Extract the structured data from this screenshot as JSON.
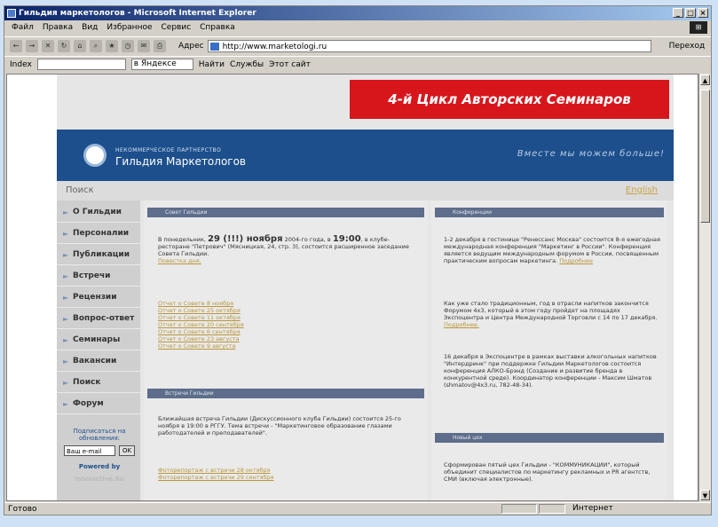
{
  "window": {
    "title": "Гильдия маркетологов - Microsoft Internet Explorer"
  },
  "menu": [
    "Файл",
    "Правка",
    "Вид",
    "Избранное",
    "Сервис",
    "Справка"
  ],
  "address": {
    "label": "Адрес",
    "url": "http://www.marketologi.ru",
    "go": "Переход"
  },
  "linksbar": {
    "left_label": "Index",
    "search_select": "в Яндексе",
    "find": "Найти",
    "services": "Службы",
    "this_site": "Этот сайт"
  },
  "status": {
    "left": "Готово",
    "zone": "Интернет"
  },
  "site": {
    "banner": "4-й Цикл Авторских Семинаров",
    "org_small": "НЕКОММЕРЧЕСКОЕ ПАРТНЕРСТВО",
    "org_big": "Гильдия Маркетологов",
    "slogan": "Вместе мы можем больше!",
    "search": "Поиск",
    "english": "English",
    "nav": [
      "О Гильдии",
      "Персоналии",
      "Публикации",
      "Встречи",
      "Рецензии",
      "Вопрос-ответ",
      "Семинары",
      "Вакансии",
      "Поиск",
      "Форум"
    ],
    "subscribe": "Подписаться на обновления:",
    "email_placeholder": "Ваш e-mail",
    "ok": "OK",
    "powered": "Powered by",
    "powered_name": "Interactive.Ru"
  },
  "council": {
    "head": "Совет Гильдии",
    "text_prefix": "В понедельник,",
    "date_big": "29 (!!!) ноября",
    "text_mid": "2004-го года, в",
    "time_big": "19:00",
    "text_rest": ", в клубе-ресторане \"Петрович\" (Мясницкая, 24, стр. 3), состоится расширенное заседание Совета Гильдии.",
    "agenda": "Повестка дня.",
    "reports": [
      "Отчет о Совете 8 ноября",
      "Отчет о Совете 25 октября",
      "Отчет о Совете 11 октября",
      "Отчет о Совете 20 сентября",
      "Отчет о Совете 6 сентября",
      "Отчет о Совете 23 августа",
      "Отчет о Совете 9 августа"
    ]
  },
  "meetings": {
    "head": "Встречи Гильдии",
    "text": "Ближайшая встреча Гильдии (Дискуссионного клуба Гильдии) состоится 25-го ноября в 19:00 в РГГУ. Тема встречи - \"Маркетинговое образование глазами работодателей и преподавателей\".",
    "links": [
      "Фоторепортаж с встречи 28 октября",
      "Фоторепортаж с встречи 29 сентября"
    ]
  },
  "conferences": {
    "head": "Конференции",
    "p1": "1-2 декабря в гостинице \"Ренессанс Москва\" состоится 8-я ежегодная международная конференция \"Маркетинг в России\". Конференция является ведущим международным форумом в России, посвященным практическим вопросам маркетинга.",
    "p1_more": "Подробнее",
    "p2": "Как уже стало традиционным, год в отрасли напитков закончится Форумом 4х3, который в этом году пройдет на площадях Экспоцентра и Центра Международной Торговли с 14 по 17 декабря.",
    "p2_more": "Подробнее.",
    "p3": "16 декабря в Экспоцентре в рамках выставки алкогольных напитков \"Интердринк\" при поддержке Гильдии Маркетологов состоится конференция АЛКО-Брэнд (Создание и развитие бренда в конкурентной среде). Координатор конференции - Максим Шматов (shmatov@4x3.ru, 782-48-34)."
  },
  "newguild": {
    "head": "Новый цех",
    "text": "Сформирован пятый цех Гильдии - \"КОММУНИКАЦИИ\", который объединит специалистов по маркетингу рекламных и PR агентств, СМИ (включая электронные)."
  }
}
